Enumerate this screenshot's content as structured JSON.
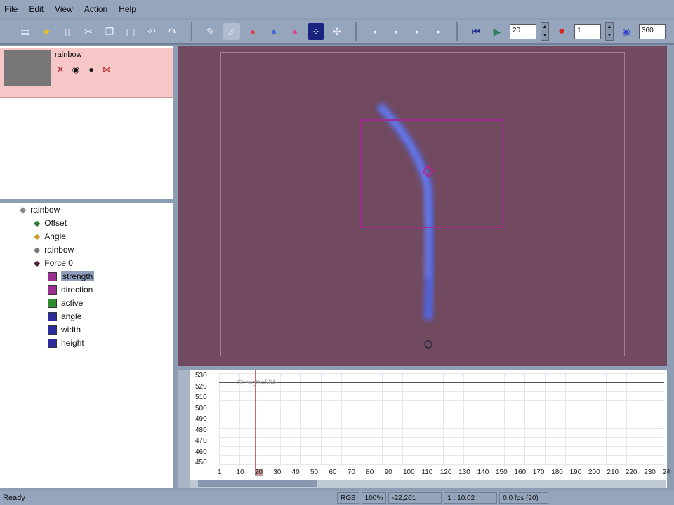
{
  "menu": [
    "File",
    "Edit",
    "View",
    "Action",
    "Help"
  ],
  "toolbar": {
    "frame_value": "20",
    "record_value": "1",
    "zoom_value": "360"
  },
  "layer": {
    "name": "rainbow"
  },
  "tree": [
    {
      "label": "rainbow",
      "icon": "group-icon",
      "color": "#888888",
      "indent": 0
    },
    {
      "label": "Offset",
      "icon": "offset-icon",
      "color": "#2e7d32",
      "indent": 1
    },
    {
      "label": "Angle",
      "icon": "angle-icon",
      "color": "#c8a030",
      "indent": 1
    },
    {
      "label": "rainbow",
      "icon": "emitter-icon",
      "color": "#777777",
      "indent": 1
    },
    {
      "label": "Force 0",
      "icon": "force-icon",
      "color": "#552244",
      "indent": 1
    },
    {
      "label": "strength",
      "icon": "swatch",
      "color": "#9b2d8f",
      "indent": 2,
      "selected": true
    },
    {
      "label": "direction",
      "icon": "swatch",
      "color": "#9b2d8f",
      "indent": 2
    },
    {
      "label": "active",
      "icon": "swatch",
      "color": "#2e8b2e",
      "indent": 2
    },
    {
      "label": "angle",
      "icon": "swatch",
      "color": "#2b2b9b",
      "indent": 2
    },
    {
      "label": "width",
      "icon": "swatch",
      "color": "#2b2b9b",
      "indent": 2
    },
    {
      "label": "height",
      "icon": "swatch",
      "color": "#2b2b9b",
      "indent": 2
    }
  ],
  "timeline": {
    "curve_label": "Strength=534",
    "y_ticks": [
      "530",
      "520",
      "510",
      "500",
      "490",
      "480",
      "470",
      "460",
      "450"
    ],
    "x_ticks": [
      "1",
      "10",
      "20",
      "30",
      "40",
      "50",
      "60",
      "70",
      "80",
      "90",
      "100",
      "110",
      "120",
      "130",
      "140",
      "150",
      "160",
      "170",
      "180",
      "190",
      "200",
      "210",
      "220",
      "230",
      "24"
    ],
    "current_frame": "20"
  },
  "status": {
    "text": "Ready",
    "mode": "RGB",
    "zoom": "100%",
    "coords": "-22,261",
    "ratio": "1 : 10.02",
    "fps": "0.0 fps (20)"
  }
}
